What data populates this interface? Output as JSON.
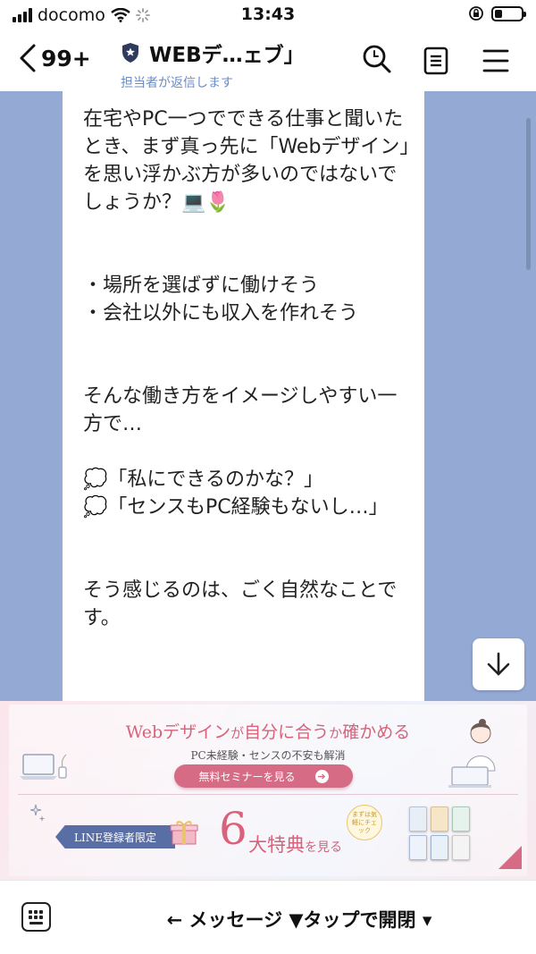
{
  "status_bar": {
    "carrier": "docomo",
    "time": "13:43"
  },
  "header": {
    "back_count": "99+",
    "title": "WEBデ…ェブ」",
    "subtitle": "担当者が返信します"
  },
  "message": {
    "paragraphs": [
      "在宅やPC一つでできる仕事と聞いたとき、まず真っ先に「Webデザイン」を思い浮かぶ方が多いのではないでしょうか？💻🌷",
      "",
      "",
      "・場所を選ばずに働けそう\n・会社以外にも収入を作れそう",
      "",
      "",
      "そんな働き方をイメージしやすい一方で…",
      "",
      "💭「私にできるのかな？」\n💭「センスもPC経験もないし…」",
      "",
      "",
      "そう感じるのは、ごく自然なことです。"
    ]
  },
  "banner": {
    "headline_part1": "Webデザイン",
    "headline_part2": "が",
    "headline_part3": "自分に合う",
    "headline_part4": "か",
    "headline_part5": "確かめる",
    "sub": "PC未経験・センスの不安も解消",
    "cta": "無料セミナーを見る",
    "ribbon": "LINE登録者限定",
    "six": "6",
    "tokuten": "大特典",
    "tokuten_tail": "を見る",
    "badge": "まずは気軽にチェック"
  },
  "bottom_bar": {
    "menu_label": "← メッセージ ▼タップで開閉 ▾"
  },
  "colors": {
    "chat_bg": "#94a9d3",
    "accent_pink": "#d9627a",
    "ribbon_blue": "#5a6ea6"
  }
}
